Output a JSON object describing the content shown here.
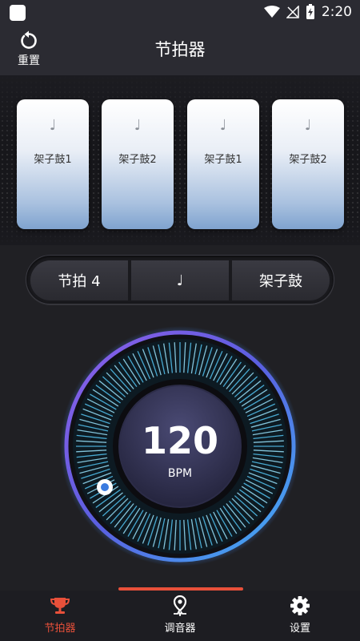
{
  "status_bar": {
    "time": "2:20"
  },
  "header": {
    "reset_label": "重置",
    "title": "节拍器"
  },
  "pads": [
    {
      "note": "♩",
      "label": "架子鼓1"
    },
    {
      "note": "♩",
      "label": "架子鼓2"
    },
    {
      "note": "♩",
      "label": "架子鼓1"
    },
    {
      "note": "♩",
      "label": "架子鼓2"
    }
  ],
  "segments": {
    "beat": "节拍 4",
    "note": "♩",
    "sound": "架子鼓"
  },
  "dial": {
    "bpm": "120",
    "unit": "BPM"
  },
  "nav": [
    {
      "label": "节拍器",
      "icon": "trophy-icon",
      "active": true
    },
    {
      "label": "调音器",
      "icon": "tuner-pin-icon",
      "active": false
    },
    {
      "label": "设置",
      "icon": "gear-icon",
      "active": false
    }
  ],
  "colors": {
    "accent": "#e8503a",
    "dial_blue": "#3fa9f5",
    "dial_purple": "#6b4fd1",
    "pad_blue": "#7fa3cf"
  }
}
